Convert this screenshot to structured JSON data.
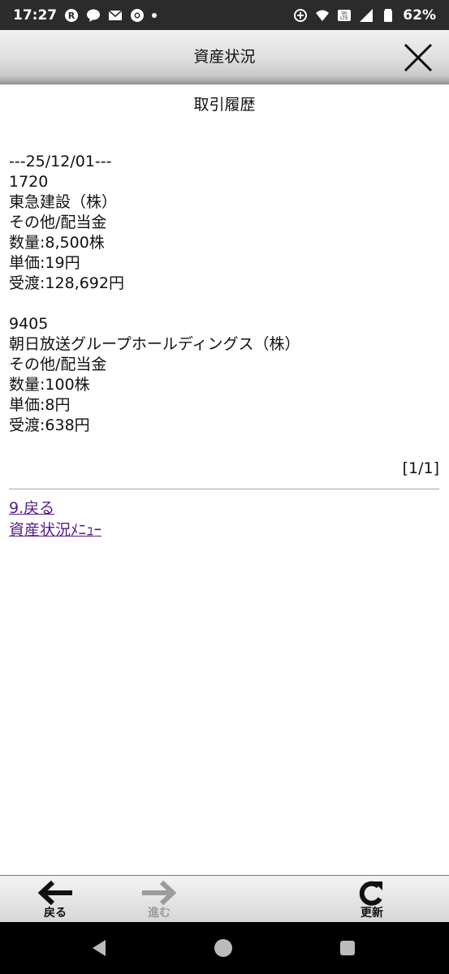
{
  "status_bar": {
    "time": "17:27",
    "battery": "62%",
    "icons": [
      "rakuten-icon",
      "line-icon",
      "mail-icon",
      "chrome-icon",
      "dot-icon",
      "hotspot-icon",
      "wifi-icon",
      "volte-icon",
      "signal-icon",
      "battery-icon"
    ]
  },
  "header": {
    "title": "資産状況"
  },
  "page": {
    "heading": "取引履歴",
    "date_line": "---25/12/01---",
    "records": [
      {
        "code": "1720",
        "name": "東急建設（株）",
        "type": "その他/配当金",
        "quantity": "数量:8,500株",
        "unit_price": "単価:19円",
        "settlement": "受渡:128,692円"
      },
      {
        "code": "9405",
        "name": "朝日放送グループホールディングス（株）",
        "type": "その他/配当金",
        "quantity": "数量:100株",
        "unit_price": "単価:8円",
        "settlement": "受渡:638円"
      }
    ],
    "pager": "[1/1]",
    "links": {
      "back": "9.戻る",
      "menu": "資産状況ﾒﾆｭｰ"
    }
  },
  "toolbar": {
    "back_label": "戻る",
    "forward_label": "進む",
    "refresh_label": "更新"
  },
  "colors": {
    "link": "#551a8b",
    "disabled": "#9c9c9c"
  }
}
